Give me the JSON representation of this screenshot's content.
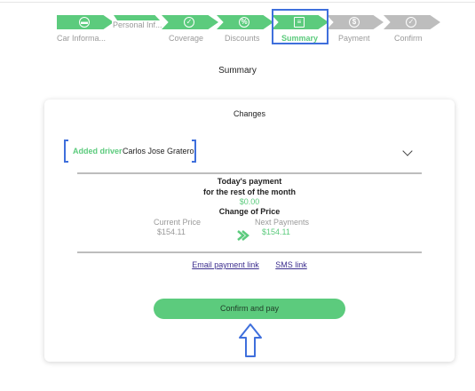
{
  "stepper": {
    "steps": [
      {
        "label": "Car Informa...",
        "status": "done",
        "icon": "car-icon"
      },
      {
        "label": "Personal Inf...",
        "status": "done",
        "icon": "person-icon"
      },
      {
        "label": "Coverage",
        "status": "done",
        "icon": "check-shield-icon"
      },
      {
        "label": "Discounts",
        "status": "done",
        "icon": "discount-icon"
      },
      {
        "label": "Summary",
        "status": "active",
        "icon": "list-icon"
      },
      {
        "label": "Payment",
        "status": "todo",
        "icon": "dollar-icon"
      },
      {
        "label": "Confirm",
        "status": "todo",
        "icon": "confirm-icon"
      }
    ]
  },
  "page_title": "Summary",
  "changes": {
    "title": "Changes",
    "driver_label": "Added driver",
    "driver_name": "Carlos Jose Graterol"
  },
  "payment": {
    "today_title": "Today's payment",
    "rest_of_month": "for the rest of the month",
    "today_amount": "$0.00",
    "change_title": "Change of Price",
    "current_label": "Current Price",
    "current_value": "$154.11",
    "next_label": "Next Payments",
    "next_value": "$154.11"
  },
  "links": {
    "email": "Email payment link",
    "sms": "SMS link"
  },
  "confirm_button": "Confirm and pay",
  "colors": {
    "accent_green": "#5ccb7d",
    "inactive_grey": "#bdbdbd",
    "highlight_blue": "#3f6fdc"
  }
}
